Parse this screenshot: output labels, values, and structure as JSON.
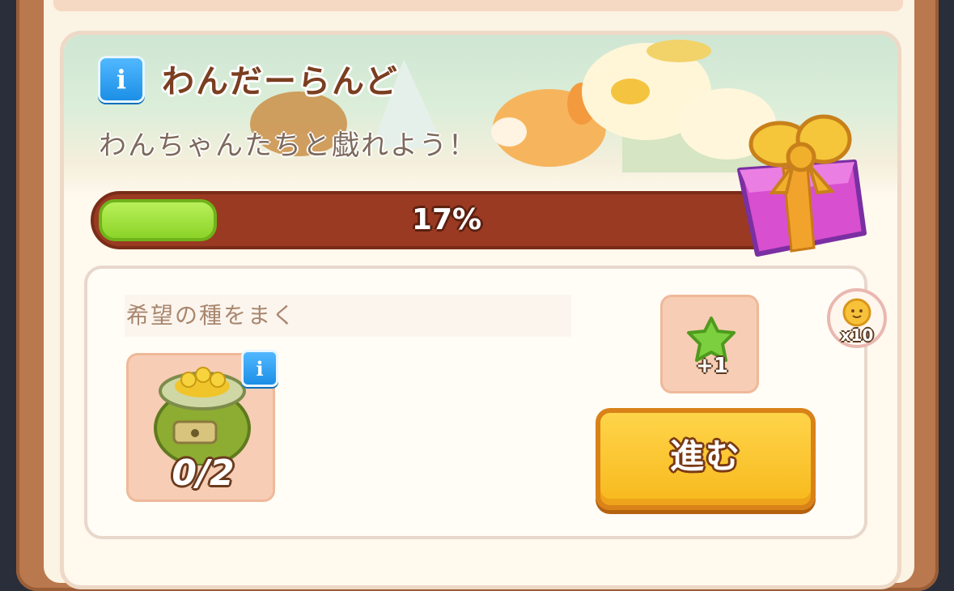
{
  "event": {
    "title": "わんだーらんど",
    "subtitle": "わんちゃんたちと戯れよう！",
    "progress_percent": 17,
    "progress_label": "17%"
  },
  "task": {
    "name": "希望の種をまく",
    "item_count": "0/2",
    "reward_amount": "+1",
    "go_button": "進む"
  },
  "bonus": {
    "label": "x10"
  },
  "colors": {
    "progress_fill": "#9bde34",
    "progress_track": "#9a3a22",
    "button": "#f7b91c",
    "info": "#1c8fe6"
  },
  "icons": [
    "info-icon",
    "gift-box-icon",
    "seed-bag-icon",
    "green-star-icon",
    "sun-coin-icon"
  ]
}
